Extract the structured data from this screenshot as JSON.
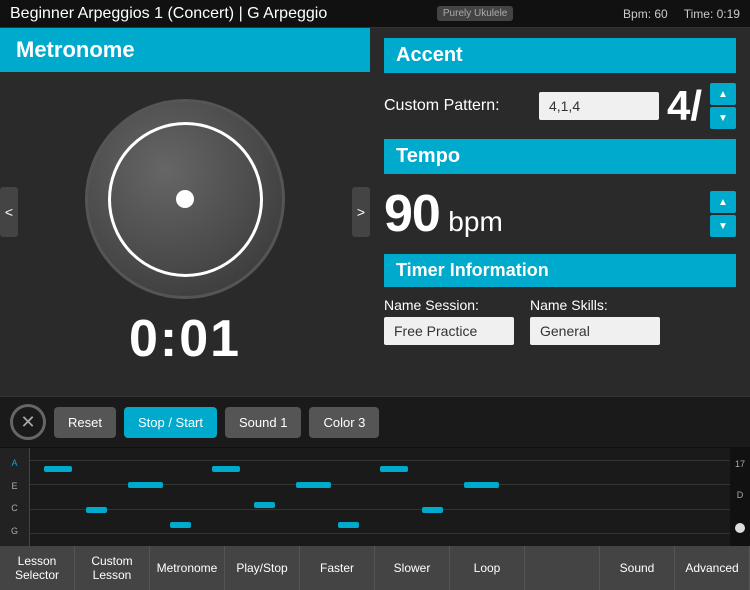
{
  "topBar": {
    "title": "Beginner Arpeggios 1 (Concert)  |  G Arpeggio",
    "logo": "Purely Ukulele",
    "bpm": "Bpm: 60",
    "time": "Time: 0:19"
  },
  "leftPanel": {
    "title": "Metronome",
    "time": "0:01",
    "navLeft": "<",
    "navRight": ">"
  },
  "rightPanel": {
    "accentTitle": "Accent",
    "customPatternLabel": "Custom Pattern:",
    "customPatternValue": "4,1,4",
    "fractionDisplay": "4/",
    "arrowUp": "▲",
    "arrowDown": "▼",
    "tempoTitle": "Tempo",
    "tempoValue": "90",
    "tempoUnit": "bpm",
    "timerTitle": "Timer Information",
    "nameSessionLabel": "Name Session:",
    "nameSkillsLabel": "Name Skills:",
    "nameSessionValue": "Free Practice",
    "nameSkillsValue": "General"
  },
  "toolbar": {
    "resetLabel": "Reset",
    "stopStartLabel": "Stop / Start",
    "sound1Label": "Sound 1",
    "color3Label": "Color 3"
  },
  "pianoKeys": [
    "A",
    "E",
    "C",
    "G"
  ],
  "bottomNav": [
    {
      "label": "Lesson Selector"
    },
    {
      "label": "Custom Lesson"
    },
    {
      "label": "Metronome"
    },
    {
      "label": "Play/Stop"
    },
    {
      "label": "Faster"
    },
    {
      "label": "Slower"
    },
    {
      "label": "Loop"
    },
    {
      "label": ""
    },
    {
      "label": "Sound"
    },
    {
      "label": "Advanced"
    }
  ]
}
